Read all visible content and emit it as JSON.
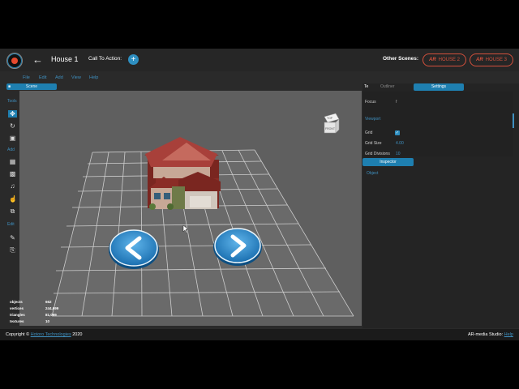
{
  "header": {
    "back_icon": "arrow-left-icon",
    "project_title": "House 1",
    "cta_label": "Call To Action:",
    "cta_add": "+",
    "other_scenes_label": "Other Scenes:",
    "scenes": [
      {
        "ar": "AR",
        "label": "HOUSE 2"
      },
      {
        "ar": "AR",
        "label": "HOUSE 3"
      }
    ],
    "brand_color": "#d3503c",
    "accent_color": "#1e7fb0"
  },
  "menu": [
    "File",
    "Edit",
    "Add",
    "View",
    "Help"
  ],
  "scene_tab": "Scene",
  "toolbar": {
    "tools_label": "Tools",
    "add_label": "Add",
    "edit_label": "Edit",
    "tools": [
      "move-icon",
      "rotate-icon",
      "scale-icon"
    ],
    "add_items": [
      "image-icon",
      "video-icon",
      "audio-icon",
      "hand-icon",
      "copy-icon"
    ],
    "edit_items": [
      "edit-icon",
      "export-icon"
    ]
  },
  "viewcube": {
    "top": "TOP",
    "front": "FRONT"
  },
  "stats": [
    {
      "label": "objects",
      "value": "662"
    },
    {
      "label": "vertices",
      "value": "244,699"
    },
    {
      "label": "triangles",
      "value": "81,099"
    },
    {
      "label": "textures",
      "value": "10"
    }
  ],
  "right_panel": {
    "tab_icon": "Te",
    "outliner": "Outliner",
    "settings": "Settings",
    "focus_label": "Focus",
    "focus_value": "f",
    "viewport_section": "Viewport",
    "grid_label": "Grid",
    "grid_checked": "✓",
    "grid_size_label": "Grid Size",
    "grid_size_value": "4.00",
    "grid_divisions_label": "Grid Divisions",
    "grid_divisions_value": "10",
    "inspector": "Inspector",
    "object_label": "Object"
  },
  "footer": {
    "copyright_prefix": "Copyright ©",
    "copyright_link": "Hotoro Technologies",
    "copyright_year": "2020",
    "studio_label": "AR-media Studio:",
    "studio_link": "Help"
  }
}
